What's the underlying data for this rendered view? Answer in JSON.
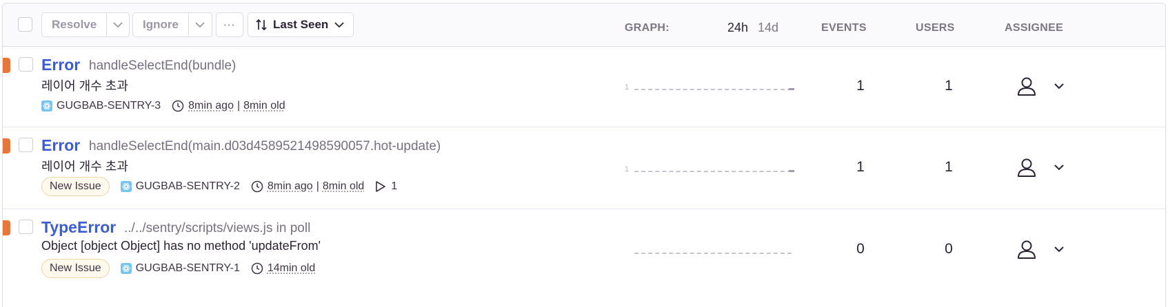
{
  "toolbar": {
    "resolve_label": "Resolve",
    "ignore_label": "Ignore",
    "more_label": "···",
    "sort_label": "Last Seen"
  },
  "columns": {
    "graph_label": "GRAPH:",
    "period_24h": "24h",
    "period_14d": "14d",
    "active_period": "24h",
    "events_label": "EVENTS",
    "users_label": "USERS",
    "assignee_label": "ASSIGNEE"
  },
  "colors": {
    "link_blue": "#3d5ccf",
    "level_error": "#ea7538",
    "badge_border": "#f0d5a8"
  },
  "issues": [
    {
      "type": "Error",
      "culprit": "handleSelectEnd(bundle)",
      "message": "레이어 개수 초과",
      "badge": "",
      "project": "GUGBAB-SENTRY-3",
      "last_seen": "8min ago",
      "age": "8min old",
      "replays": "",
      "sparkline_axis": "1",
      "events": "1",
      "users": "1",
      "assignee_icon": "user-icon"
    },
    {
      "type": "Error",
      "culprit": "handleSelectEnd(main.d03d4589521498590057.hot-update)",
      "message": "레이어 개수 초과",
      "badge": "New Issue",
      "project": "GUGBAB-SENTRY-2",
      "last_seen": "8min ago",
      "age": "8min old",
      "replays": "1",
      "sparkline_axis": "1",
      "events": "1",
      "users": "1",
      "assignee_icon": "user-icon"
    },
    {
      "type": "TypeError",
      "culprit": "../../sentry/scripts/views.js in poll",
      "message": "Object [object Object] has no method 'updateFrom'",
      "badge": "New Issue",
      "project": "GUGBAB-SENTRY-1",
      "last_seen": "",
      "age": "14min old",
      "replays": "",
      "sparkline_axis": "",
      "events": "0",
      "users": "0",
      "assignee_icon": "user-icon"
    }
  ]
}
